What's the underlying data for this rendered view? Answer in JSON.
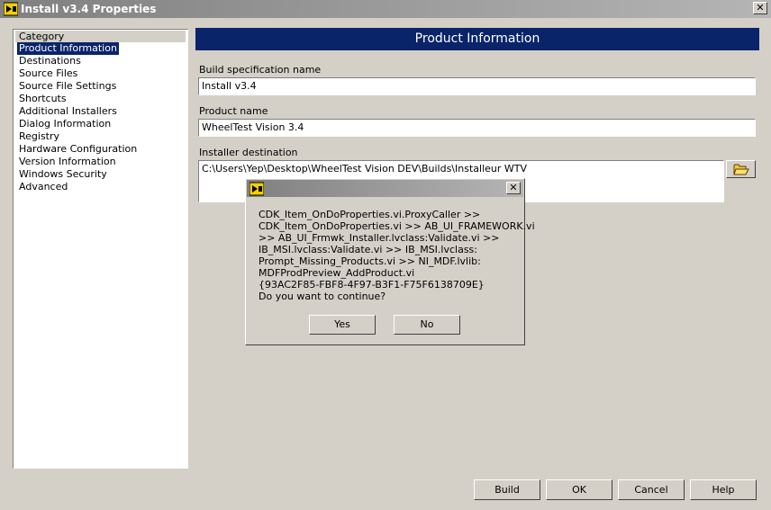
{
  "window": {
    "title": "Install v3.4 Properties",
    "close_glyph": "✕"
  },
  "category_panel": {
    "header": "Category",
    "items": [
      "Product Information",
      "Destinations",
      "Source Files",
      "Source File Settings",
      "Shortcuts",
      "Additional Installers",
      "Dialog Information",
      "Registry",
      "Hardware Configuration",
      "Version Information",
      "Windows Security",
      "Advanced"
    ],
    "selected": "Product Information"
  },
  "page": {
    "title": "Product Information",
    "build_spec_label": "Build specification name",
    "build_spec_value": "Install v3.4",
    "product_name_label": "Product name",
    "product_name_value": "WheelTest Vision 3.4",
    "installer_dest_label": "Installer destination",
    "installer_dest_value": "C:\\Users\\Yep\\Desktop\\WheelTest Vision DEV\\Builds\\Installeur WTV",
    "browse_icon": "folder-open-icon"
  },
  "buttons": {
    "build": "Build",
    "ok": "OK",
    "cancel": "Cancel",
    "help": "Help"
  },
  "dialog": {
    "message_lines": [
      "CDK_Item_OnDoProperties.vi.ProxyCaller >>",
      "CDK_Item_OnDoProperties.vi >> AB_UI_FRAMEWORK.vi",
      ">> AB_UI_Frmwk_Installer.lvclass:Validate.vi >>",
      "IB_MSI.lvclass:Validate.vi >> IB_MSI.lvclass:",
      "Prompt_Missing_Products.vi >> NI_MDF.lvlib:",
      "MDFProdPreview_AddProduct.vi",
      "{93AC2F85-FBF8-4F97-B3F1-F75F6138709E}",
      "Do you want to continue?"
    ],
    "yes": "Yes",
    "no": "No",
    "close_glyph": "✕"
  }
}
